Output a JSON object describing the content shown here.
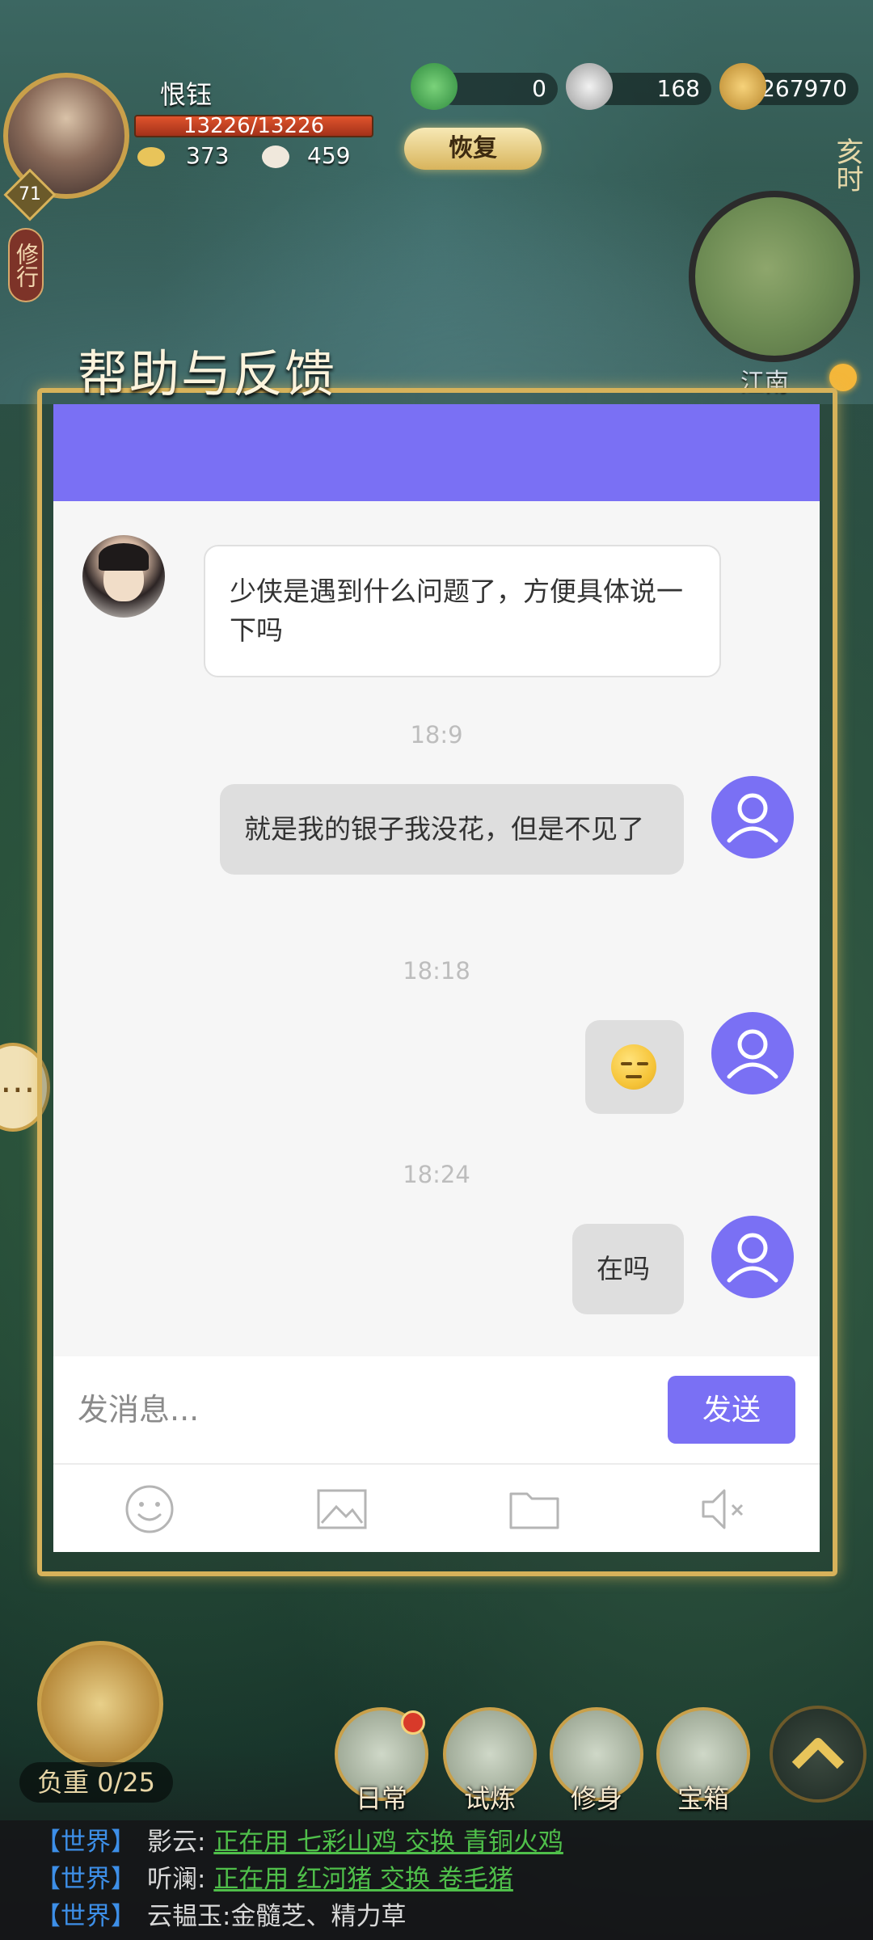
{
  "hud": {
    "player_name": "恨钰",
    "hp": "13226/13226",
    "level": "71",
    "stat_a": "373",
    "stat_b": "459",
    "res_1": "0",
    "res_2": "168",
    "res_3": "267970",
    "restore_label": "恢复",
    "practice_label": "修行",
    "time_label": "亥时",
    "region": "江南"
  },
  "dialog": {
    "title": "帮助与反馈",
    "messages": [
      {
        "from": "bot",
        "text": "少侠是遇到什么问题了，方便具体说一下吗"
      },
      {
        "time": "18:9"
      },
      {
        "from": "user",
        "text": "就是我的银子我没花，但是不见了"
      },
      {
        "time": "18:18"
      },
      {
        "from": "user",
        "emoji": "unamused-face"
      },
      {
        "time": "18:24"
      },
      {
        "from": "user",
        "text": "在吗"
      }
    ],
    "input_placeholder": "发消息...",
    "send_label": "发送",
    "toolbar": [
      "smile-icon",
      "image-icon",
      "folder-icon",
      "mute-icon"
    ]
  },
  "bottom": {
    "weight_label": "负重 0/25",
    "buttons": [
      "日常",
      "试炼",
      "修身",
      "宝箱"
    ]
  },
  "chat_log": [
    {
      "channel": "【世界】",
      "user": "影云:",
      "link": "正在用 七彩山鸡 交换 青铜火鸡"
    },
    {
      "channel": "【世界】",
      "user": "听澜:",
      "link": "正在用 红河猪 交换 卷毛猪"
    },
    {
      "channel": "【世界】",
      "user": "云韫玉:",
      "text": "金髓芝、精力草"
    }
  ],
  "colors": {
    "accent": "#7a70f4",
    "frame_gold": "#d7b25a",
    "chat_channel": "#3d8fe8",
    "chat_link": "#4fbf4a"
  }
}
